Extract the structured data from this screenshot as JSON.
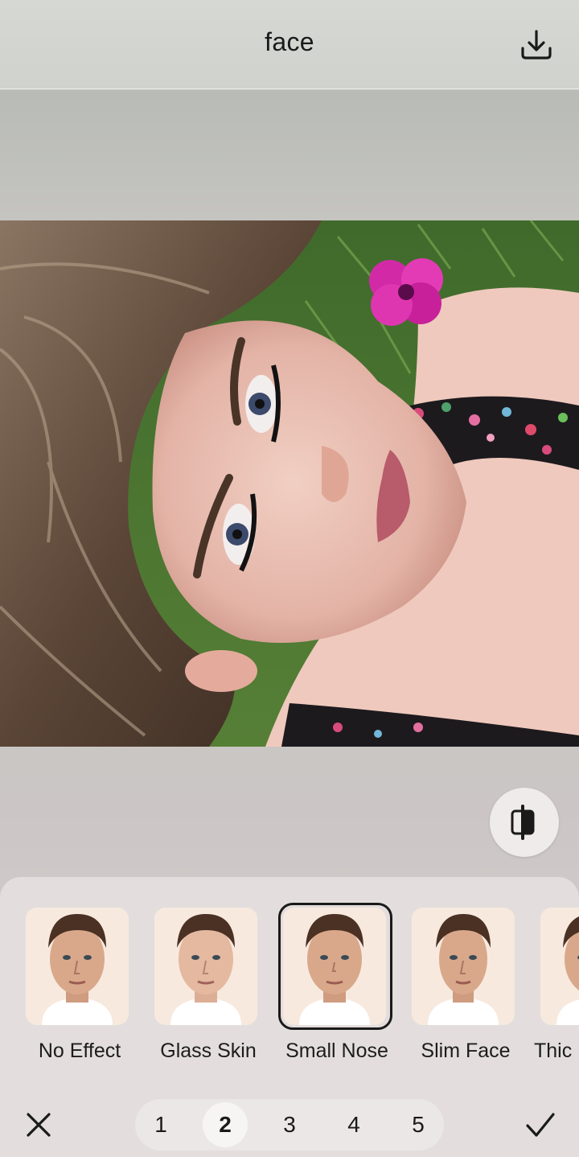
{
  "header": {
    "title": "face",
    "download_icon": "download-icon"
  },
  "compare": {
    "icon": "compare-split-icon"
  },
  "effects": [
    {
      "label": "No Effect",
      "selected": false
    },
    {
      "label": "Glass Skin",
      "selected": false
    },
    {
      "label": "Small Nose",
      "selected": true
    },
    {
      "label": "Slim Face",
      "selected": false
    },
    {
      "label": "Thic",
      "selected": false
    }
  ],
  "intensity": {
    "levels": [
      "1",
      "2",
      "3",
      "4",
      "5"
    ],
    "selected": "2"
  },
  "actions": {
    "cancel_icon": "close-icon",
    "confirm_icon": "check-icon"
  }
}
